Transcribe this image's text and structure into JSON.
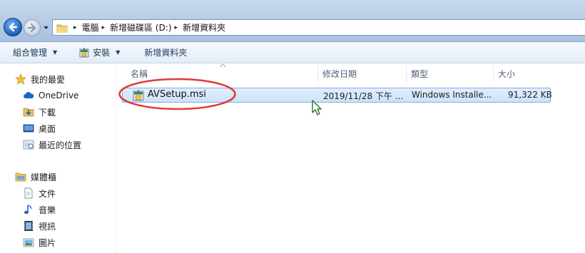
{
  "address": {
    "breadcrumbs": [
      "電腦",
      "新增磁碟區 (D:)",
      "新增資料夾"
    ],
    "separator": "▸"
  },
  "toolbar": {
    "organize_label": "組合管理",
    "install_label": "安裝",
    "new_folder_label": "新增資料夾",
    "dropdown_glyph": "▼"
  },
  "sidebar": {
    "favorites": {
      "label": "我的最愛",
      "items": [
        {
          "label": "OneDrive",
          "icon": "cloud-icon"
        },
        {
          "label": "下載",
          "icon": "downloads-icon"
        },
        {
          "label": "桌面",
          "icon": "desktop-icon"
        },
        {
          "label": "最近的位置",
          "icon": "recent-places-icon"
        }
      ]
    },
    "libraries": {
      "label": "媒體櫃",
      "items": [
        {
          "label": "文件",
          "icon": "documents-icon"
        },
        {
          "label": "音樂",
          "icon": "music-icon"
        },
        {
          "label": "視訊",
          "icon": "video-icon"
        },
        {
          "label": "圖片",
          "icon": "pictures-icon"
        }
      ]
    }
  },
  "columns": {
    "name": "名稱",
    "date": "修改日期",
    "type": "類型",
    "size": "大小"
  },
  "files": [
    {
      "name": "AVSetup.msi",
      "date": "2019/11/28 下午 ...",
      "type": "Windows Installe...",
      "size": "91,322 KB",
      "icon": "msi-installer-icon"
    }
  ],
  "colors": {
    "selection": "#cde3fa",
    "annotation": "#e03a3a",
    "accent": "#1c5fb8"
  }
}
